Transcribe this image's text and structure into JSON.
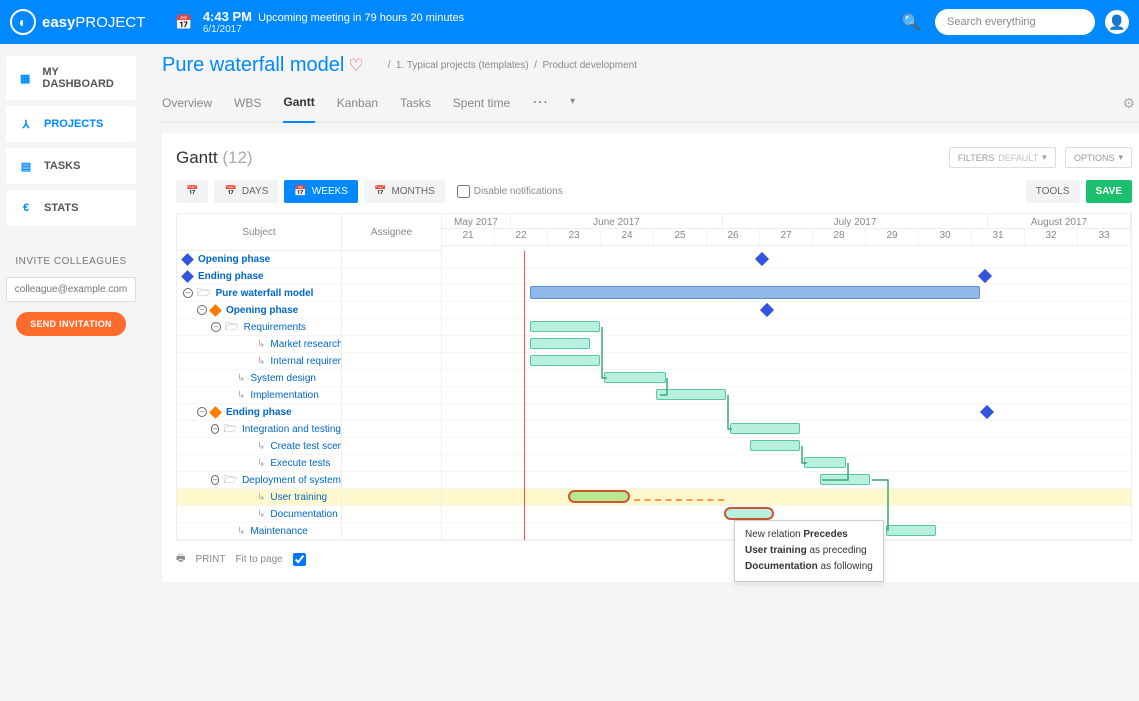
{
  "brand": {
    "name_bold": "easy",
    "name_light": "PROJECT"
  },
  "header": {
    "time": "4:43 PM",
    "date": "6/1/2017",
    "upcoming": "Upcoming meeting in 79 hours 20 minutes",
    "search_placeholder": "Search everything"
  },
  "nav": {
    "dashboard": "MY DASHBOARD",
    "projects": "PROJECTS",
    "tasks": "TASKS",
    "stats": "STATS"
  },
  "invite": {
    "title": "INVITE COLLEAGUES",
    "placeholder": "colleague@example.com",
    "button": "SEND INVITATION"
  },
  "breadcrumb": {
    "a": "1. Typical projects (templates)",
    "b": "Product development"
  },
  "page_title": "Pure waterfall model",
  "tabs": {
    "overview": "Overview",
    "wbs": "WBS",
    "gantt": "Gantt",
    "kanban": "Kanban",
    "tasks": "Tasks",
    "spent": "Spent time"
  },
  "gantt_head": {
    "title": "Gantt",
    "count": "(12)"
  },
  "filters": {
    "label": "FILTERS",
    "default": "DEFAULT",
    "options": "OPTIONS"
  },
  "toolbar": {
    "days": "DAYS",
    "weeks": "WEEKS",
    "months": "MONTHS",
    "disable": "Disable notifications",
    "tools": "TOOLS",
    "save": "SAVE"
  },
  "columns": {
    "subject": "Subject",
    "assignee": "Assignee"
  },
  "months": {
    "may": "May 2017",
    "june": "June 2017",
    "july": "July 2017",
    "aug": "August 2017"
  },
  "weeks": [
    "21",
    "22",
    "23",
    "24",
    "25",
    "26",
    "27",
    "28",
    "29",
    "30",
    "31",
    "32",
    "33"
  ],
  "rows": {
    "opening": "Opening phase",
    "ending": "Ending phase",
    "project": "Pure waterfall model",
    "opening2": "Opening phase",
    "req": "Requirements",
    "market": "Market research",
    "internal": "Internal requirements",
    "sysdesign": "System design",
    "impl": "Implementation",
    "ending2": "Ending phase",
    "inttest": "Integration and testing",
    "createtest": "Create test scenarios",
    "exectest": "Execute tests",
    "deploy": "Deployment of system",
    "usertrain": "User training",
    "doc": "Documentation",
    "maint": "Maintenance"
  },
  "tooltip": {
    "l1a": "New relation ",
    "l1b": "Precedes",
    "l2a": "User training",
    "l2b": " as preceding",
    "l3a": "Documentation",
    "l3b": " as following"
  },
  "print": {
    "label": "PRINT",
    "fit": "Fit to page"
  },
  "chart_data": {
    "type": "gantt",
    "timeline_weeks": [
      "21",
      "22",
      "23",
      "24",
      "25",
      "26",
      "27",
      "28",
      "29",
      "30",
      "31",
      "32",
      "33"
    ],
    "today_week": "22",
    "milestones": [
      {
        "name": "Opening phase",
        "week": "27"
      },
      {
        "name": "Ending phase",
        "week": "31"
      },
      {
        "name": "Opening phase (sub)",
        "week": "27"
      },
      {
        "name": "Ending phase (sub)",
        "week": "31"
      }
    ],
    "bars": [
      {
        "name": "Pure waterfall model",
        "start_week": "22",
        "end_week": "31",
        "type": "summary"
      },
      {
        "name": "Requirements",
        "start_week": "22",
        "end_week": "23",
        "type": "task"
      },
      {
        "name": "Market research",
        "start_week": "22",
        "end_week": "23",
        "type": "task"
      },
      {
        "name": "Internal requirements",
        "start_week": "22",
        "end_week": "23",
        "type": "task"
      },
      {
        "name": "System design",
        "start_week": "23",
        "end_week": "25",
        "type": "task"
      },
      {
        "name": "Implementation",
        "start_week": "25",
        "end_week": "26",
        "type": "task"
      },
      {
        "name": "Integration and testing",
        "start_week": "26",
        "end_week": "28",
        "type": "task"
      },
      {
        "name": "Create test scenarios",
        "start_week": "27",
        "end_week": "28",
        "type": "task"
      },
      {
        "name": "Execute tests",
        "start_week": "28",
        "end_week": "29",
        "type": "task"
      },
      {
        "name": "Deployment of system",
        "start_week": "28",
        "end_week": "30",
        "type": "task"
      },
      {
        "name": "User training",
        "start_week": "23",
        "end_week": "24",
        "type": "highlighted"
      },
      {
        "name": "Documentation",
        "start_week": "26",
        "end_week": "27",
        "type": "related"
      },
      {
        "name": "Maintenance",
        "start_week": "30",
        "end_week": "31",
        "type": "task"
      }
    ],
    "relations": [
      {
        "from": "User training",
        "to": "Documentation",
        "type": "Precedes"
      }
    ]
  }
}
